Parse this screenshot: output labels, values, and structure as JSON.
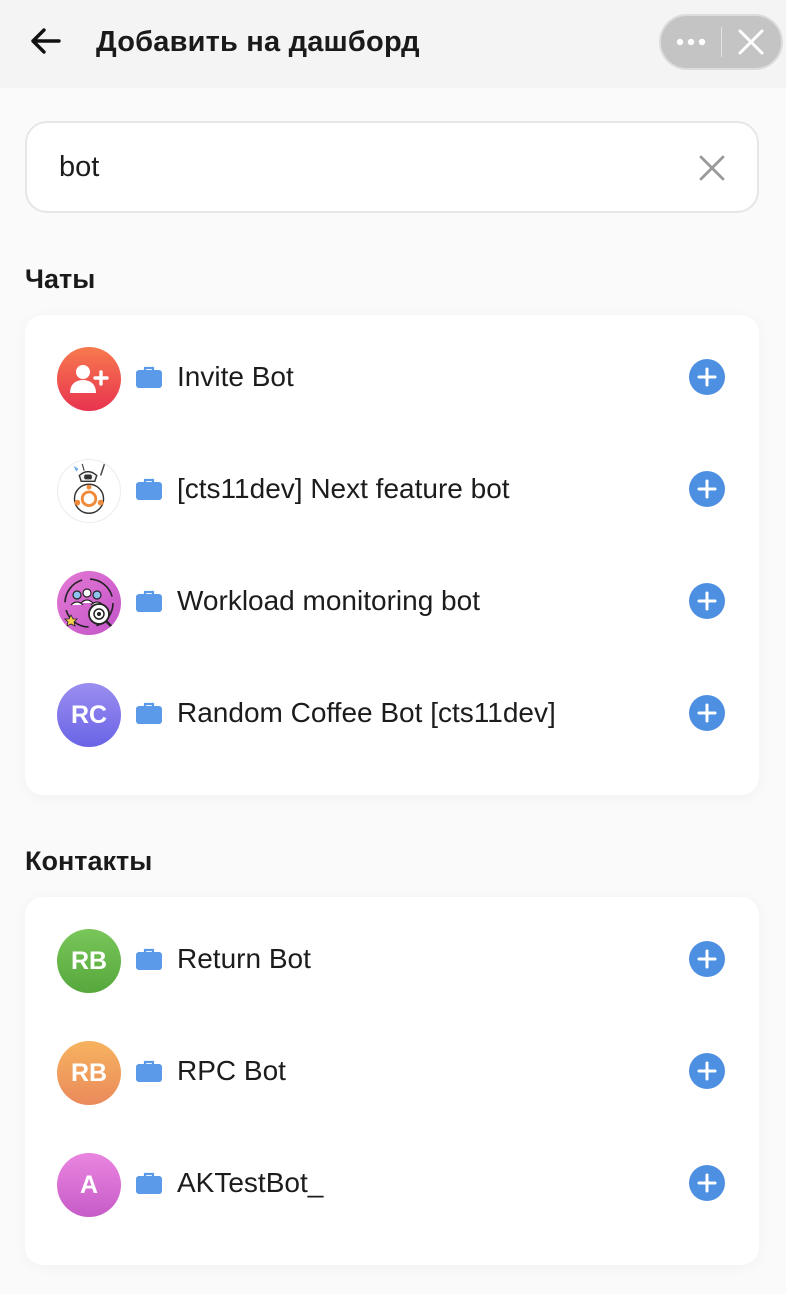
{
  "header": {
    "title": "Добавить на дашборд",
    "back_icon": "arrow-left-icon",
    "more_icon": "more-dots-icon",
    "close_icon": "close-icon"
  },
  "search": {
    "value": "bot",
    "clear_icon": "clear-x-icon"
  },
  "sections": {
    "chats": {
      "title": "Чаты",
      "items": [
        {
          "label": "Invite Bot",
          "avatar": "person-add-icon"
        },
        {
          "label": "[cts11dev] Next feature bot",
          "avatar": "robot-image"
        },
        {
          "label": "Workload monitoring bot",
          "avatar": "team-eye-image"
        },
        {
          "label": "Random Coffee Bot [cts11dev]",
          "avatar_initials": "RC"
        }
      ]
    },
    "contacts": {
      "title": "Контакты",
      "items": [
        {
          "label": "Return Bot",
          "avatar_initials": "RB"
        },
        {
          "label": "RPC Bot",
          "avatar_initials": "RB"
        },
        {
          "label": "AKTestBot_",
          "avatar_initials": "A"
        }
      ]
    }
  },
  "colors": {
    "accent_blue": "#4d8fe1",
    "briefcase_blue": "#5a9ae8",
    "avatar_red": "#ee4a52",
    "avatar_purple": "#7d72e8",
    "avatar_green": "#64b447",
    "avatar_orange": "#eea05e",
    "avatar_pink": "#d46bd4"
  }
}
